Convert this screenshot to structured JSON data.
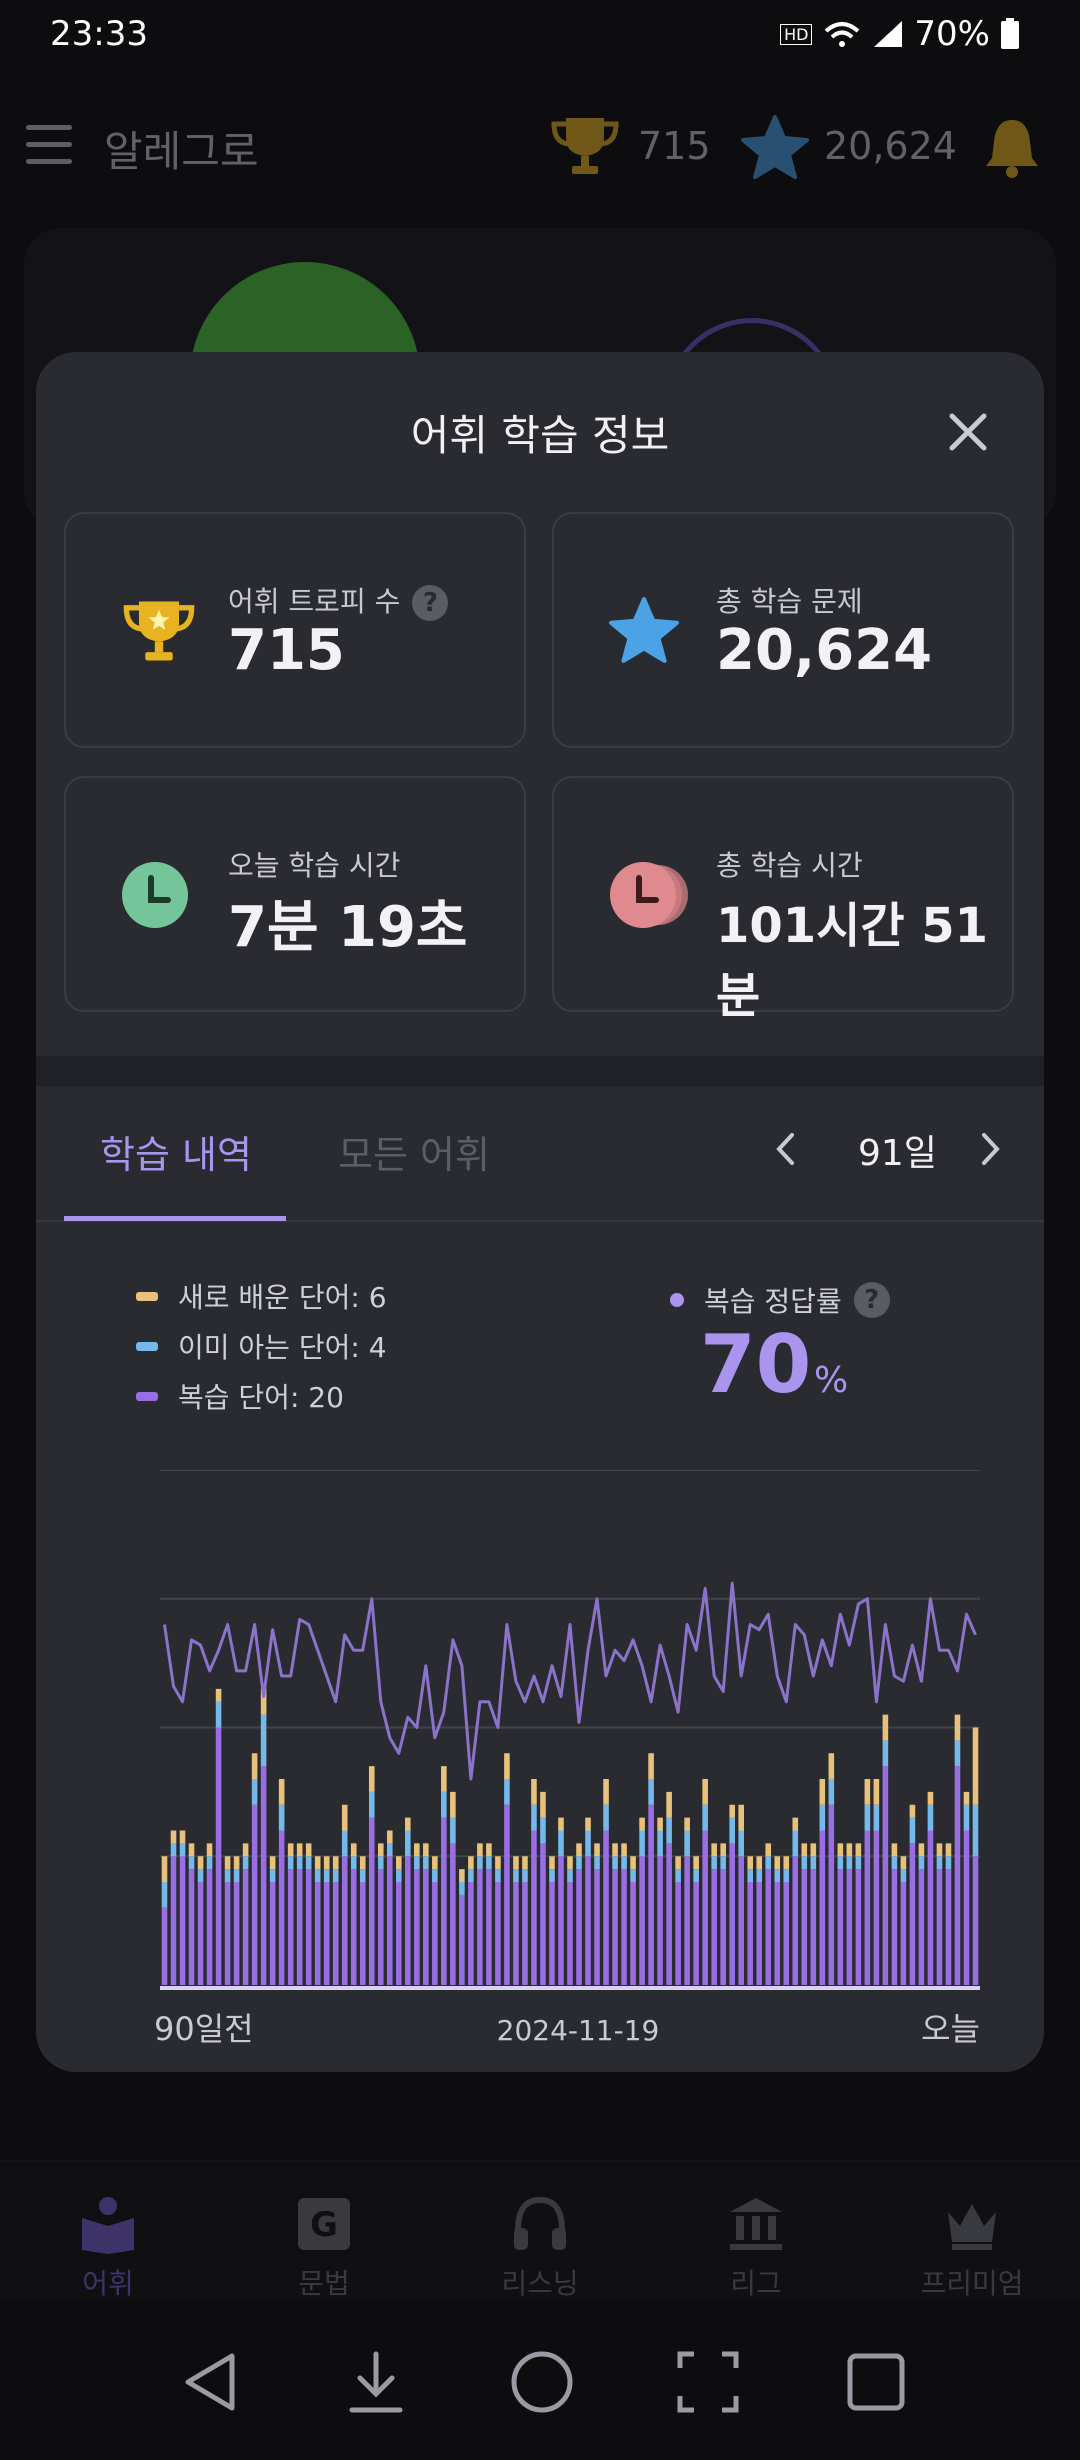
{
  "status_bar": {
    "time": "23:33",
    "battery": "70%"
  },
  "header": {
    "title": "알레그로",
    "trophies": "715",
    "stars": "20,624"
  },
  "modal": {
    "title": "어휘 학습 정보",
    "stats": {
      "trophy_label": "어휘 트로피 수",
      "trophy_value": "715",
      "total_problems_label": "총 학습 문제",
      "total_problems_value": "20,624",
      "today_time_label": "오늘 학습 시간",
      "today_time_value": "7분 19초",
      "total_time_label": "총 학습 시간",
      "total_time_value": "101시간 51분"
    },
    "tabs": {
      "history": "학습 내역",
      "all_words": "모든 어휘"
    },
    "period": "91일",
    "legend": {
      "new_words": "새로 배운 단어: 6",
      "known_words": "이미 아는 단어: 4",
      "review_words": "복습 단어: 20"
    },
    "accuracy": {
      "label": "복습 정답률",
      "value": "70",
      "unit": "%"
    },
    "chart_x_labels": {
      "start": "90일전",
      "middle": "2024-11-19",
      "end": "오늘"
    }
  },
  "colors": {
    "accent": "#a994ee",
    "new": "#e8c27a",
    "known": "#74b9ea",
    "review": "#9a6ee3",
    "line": "#8a73c9",
    "trophy": "#e7b321",
    "star": "#4ba3e6",
    "clock_today": "#74c69a",
    "clock_total": "#e08a8f"
  },
  "chart_data": {
    "type": "bar",
    "stacked": true,
    "days": 91,
    "x_labels": [
      "90일전",
      "2024-11-19",
      "오늘"
    ],
    "series": [
      {
        "name": "복습 단어",
        "values": [
          6,
          10,
          10,
          9,
          8,
          9,
          20,
          8,
          8,
          9,
          14,
          17,
          8,
          12,
          9,
          9,
          9,
          8,
          8,
          8,
          10,
          9,
          8,
          13,
          9,
          10,
          8,
          10,
          9,
          9,
          8,
          13,
          11,
          7,
          8,
          9,
          9,
          8,
          14,
          8,
          8,
          12,
          11,
          8,
          10,
          8,
          9,
          10,
          9,
          12,
          9,
          9,
          8,
          10,
          14,
          10,
          11,
          8,
          10,
          8,
          12,
          9,
          9,
          11,
          10,
          8,
          8,
          9,
          8,
          8,
          10,
          9,
          9,
          12,
          14,
          9,
          9,
          9,
          12,
          12,
          17,
          9,
          8,
          11,
          9,
          12,
          9,
          9,
          17,
          12,
          10
        ]
      },
      {
        "name": "이미 아는 단어",
        "values": [
          2,
          1,
          1,
          1,
          1,
          1,
          2,
          1,
          1,
          1,
          2,
          4,
          1,
          2,
          1,
          1,
          1,
          1,
          1,
          1,
          2,
          1,
          1,
          2,
          1,
          1,
          1,
          2,
          1,
          1,
          1,
          2,
          2,
          1,
          1,
          1,
          1,
          1,
          2,
          1,
          1,
          2,
          2,
          1,
          2,
          1,
          1,
          2,
          1,
          2,
          1,
          1,
          1,
          2,
          2,
          2,
          2,
          1,
          2,
          1,
          2,
          1,
          1,
          2,
          2,
          1,
          1,
          1,
          1,
          1,
          2,
          1,
          1,
          2,
          2,
          1,
          1,
          1,
          2,
          2,
          2,
          1,
          1,
          2,
          1,
          2,
          1,
          1,
          2,
          2,
          4
        ]
      },
      {
        "name": "새로 배운 단어",
        "values": [
          2,
          1,
          1,
          1,
          1,
          1,
          1,
          1,
          1,
          1,
          2,
          2,
          1,
          2,
          1,
          1,
          1,
          1,
          1,
          1,
          2,
          1,
          1,
          2,
          1,
          1,
          1,
          1,
          1,
          1,
          1,
          2,
          2,
          1,
          1,
          1,
          1,
          1,
          2,
          1,
          1,
          2,
          2,
          1,
          1,
          1,
          1,
          1,
          1,
          2,
          1,
          1,
          1,
          1,
          2,
          1,
          2,
          1,
          1,
          1,
          2,
          1,
          1,
          1,
          2,
          1,
          1,
          1,
          1,
          1,
          1,
          1,
          1,
          2,
          2,
          1,
          1,
          1,
          2,
          2,
          2,
          1,
          1,
          1,
          1,
          1,
          1,
          1,
          2,
          1,
          6
        ]
      }
    ],
    "line": {
      "name": "복습 정답률",
      "values": [
        70,
        58,
        55,
        67,
        66,
        61,
        65,
        70,
        61,
        61,
        70,
        56,
        69,
        60,
        60,
        71,
        70,
        65,
        60,
        55,
        68,
        65,
        65,
        75,
        55,
        48,
        45,
        52,
        50,
        62,
        48,
        53,
        67,
        62,
        40,
        55,
        55,
        50,
        70,
        59,
        55,
        60,
        55,
        62,
        56,
        70,
        51,
        65,
        75,
        60,
        65,
        63,
        67,
        62,
        55,
        66,
        60,
        53,
        70,
        65,
        77,
        60,
        57,
        78,
        60,
        70,
        69,
        72,
        60,
        55,
        70,
        68,
        60,
        67,
        62,
        72,
        66,
        74,
        75,
        55,
        70,
        60,
        59,
        66,
        59,
        75,
        65,
        65,
        61,
        72,
        68
      ]
    },
    "ylim": [
      0,
      40
    ]
  }
}
